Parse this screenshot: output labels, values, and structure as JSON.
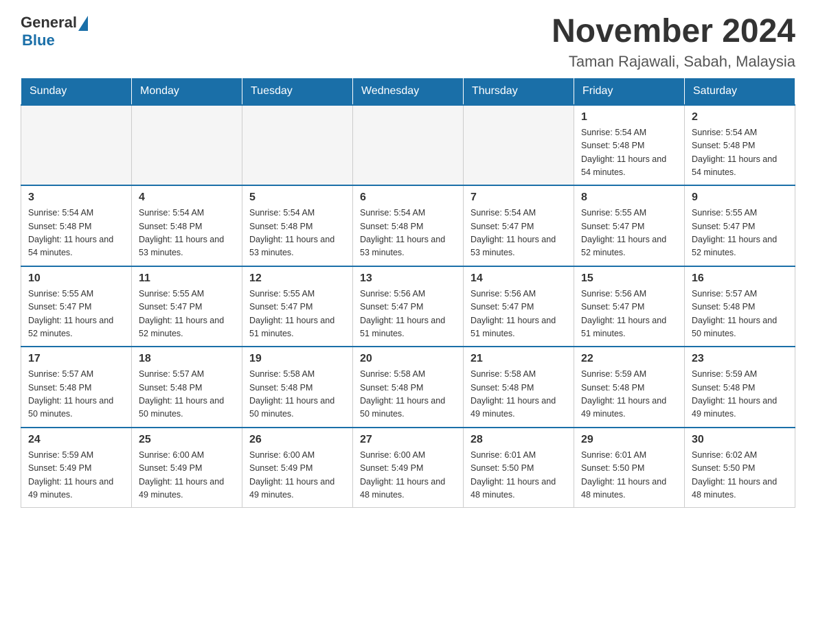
{
  "logo": {
    "general": "General",
    "blue": "Blue"
  },
  "title": "November 2024",
  "subtitle": "Taman Rajawali, Sabah, Malaysia",
  "days_of_week": [
    "Sunday",
    "Monday",
    "Tuesday",
    "Wednesday",
    "Thursday",
    "Friday",
    "Saturday"
  ],
  "weeks": [
    {
      "days": [
        {
          "number": "",
          "empty": true
        },
        {
          "number": "",
          "empty": true
        },
        {
          "number": "",
          "empty": true
        },
        {
          "number": "",
          "empty": true
        },
        {
          "number": "",
          "empty": true
        },
        {
          "number": "1",
          "sunrise": "Sunrise: 5:54 AM",
          "sunset": "Sunset: 5:48 PM",
          "daylight": "Daylight: 11 hours and 54 minutes."
        },
        {
          "number": "2",
          "sunrise": "Sunrise: 5:54 AM",
          "sunset": "Sunset: 5:48 PM",
          "daylight": "Daylight: 11 hours and 54 minutes."
        }
      ]
    },
    {
      "days": [
        {
          "number": "3",
          "sunrise": "Sunrise: 5:54 AM",
          "sunset": "Sunset: 5:48 PM",
          "daylight": "Daylight: 11 hours and 54 minutes."
        },
        {
          "number": "4",
          "sunrise": "Sunrise: 5:54 AM",
          "sunset": "Sunset: 5:48 PM",
          "daylight": "Daylight: 11 hours and 53 minutes."
        },
        {
          "number": "5",
          "sunrise": "Sunrise: 5:54 AM",
          "sunset": "Sunset: 5:48 PM",
          "daylight": "Daylight: 11 hours and 53 minutes."
        },
        {
          "number": "6",
          "sunrise": "Sunrise: 5:54 AM",
          "sunset": "Sunset: 5:48 PM",
          "daylight": "Daylight: 11 hours and 53 minutes."
        },
        {
          "number": "7",
          "sunrise": "Sunrise: 5:54 AM",
          "sunset": "Sunset: 5:47 PM",
          "daylight": "Daylight: 11 hours and 53 minutes."
        },
        {
          "number": "8",
          "sunrise": "Sunrise: 5:55 AM",
          "sunset": "Sunset: 5:47 PM",
          "daylight": "Daylight: 11 hours and 52 minutes."
        },
        {
          "number": "9",
          "sunrise": "Sunrise: 5:55 AM",
          "sunset": "Sunset: 5:47 PM",
          "daylight": "Daylight: 11 hours and 52 minutes."
        }
      ]
    },
    {
      "days": [
        {
          "number": "10",
          "sunrise": "Sunrise: 5:55 AM",
          "sunset": "Sunset: 5:47 PM",
          "daylight": "Daylight: 11 hours and 52 minutes."
        },
        {
          "number": "11",
          "sunrise": "Sunrise: 5:55 AM",
          "sunset": "Sunset: 5:47 PM",
          "daylight": "Daylight: 11 hours and 52 minutes."
        },
        {
          "number": "12",
          "sunrise": "Sunrise: 5:55 AM",
          "sunset": "Sunset: 5:47 PM",
          "daylight": "Daylight: 11 hours and 51 minutes."
        },
        {
          "number": "13",
          "sunrise": "Sunrise: 5:56 AM",
          "sunset": "Sunset: 5:47 PM",
          "daylight": "Daylight: 11 hours and 51 minutes."
        },
        {
          "number": "14",
          "sunrise": "Sunrise: 5:56 AM",
          "sunset": "Sunset: 5:47 PM",
          "daylight": "Daylight: 11 hours and 51 minutes."
        },
        {
          "number": "15",
          "sunrise": "Sunrise: 5:56 AM",
          "sunset": "Sunset: 5:47 PM",
          "daylight": "Daylight: 11 hours and 51 minutes."
        },
        {
          "number": "16",
          "sunrise": "Sunrise: 5:57 AM",
          "sunset": "Sunset: 5:48 PM",
          "daylight": "Daylight: 11 hours and 50 minutes."
        }
      ]
    },
    {
      "days": [
        {
          "number": "17",
          "sunrise": "Sunrise: 5:57 AM",
          "sunset": "Sunset: 5:48 PM",
          "daylight": "Daylight: 11 hours and 50 minutes."
        },
        {
          "number": "18",
          "sunrise": "Sunrise: 5:57 AM",
          "sunset": "Sunset: 5:48 PM",
          "daylight": "Daylight: 11 hours and 50 minutes."
        },
        {
          "number": "19",
          "sunrise": "Sunrise: 5:58 AM",
          "sunset": "Sunset: 5:48 PM",
          "daylight": "Daylight: 11 hours and 50 minutes."
        },
        {
          "number": "20",
          "sunrise": "Sunrise: 5:58 AM",
          "sunset": "Sunset: 5:48 PM",
          "daylight": "Daylight: 11 hours and 50 minutes."
        },
        {
          "number": "21",
          "sunrise": "Sunrise: 5:58 AM",
          "sunset": "Sunset: 5:48 PM",
          "daylight": "Daylight: 11 hours and 49 minutes."
        },
        {
          "number": "22",
          "sunrise": "Sunrise: 5:59 AM",
          "sunset": "Sunset: 5:48 PM",
          "daylight": "Daylight: 11 hours and 49 minutes."
        },
        {
          "number": "23",
          "sunrise": "Sunrise: 5:59 AM",
          "sunset": "Sunset: 5:48 PM",
          "daylight": "Daylight: 11 hours and 49 minutes."
        }
      ]
    },
    {
      "days": [
        {
          "number": "24",
          "sunrise": "Sunrise: 5:59 AM",
          "sunset": "Sunset: 5:49 PM",
          "daylight": "Daylight: 11 hours and 49 minutes."
        },
        {
          "number": "25",
          "sunrise": "Sunrise: 6:00 AM",
          "sunset": "Sunset: 5:49 PM",
          "daylight": "Daylight: 11 hours and 49 minutes."
        },
        {
          "number": "26",
          "sunrise": "Sunrise: 6:00 AM",
          "sunset": "Sunset: 5:49 PM",
          "daylight": "Daylight: 11 hours and 49 minutes."
        },
        {
          "number": "27",
          "sunrise": "Sunrise: 6:00 AM",
          "sunset": "Sunset: 5:49 PM",
          "daylight": "Daylight: 11 hours and 48 minutes."
        },
        {
          "number": "28",
          "sunrise": "Sunrise: 6:01 AM",
          "sunset": "Sunset: 5:50 PM",
          "daylight": "Daylight: 11 hours and 48 minutes."
        },
        {
          "number": "29",
          "sunrise": "Sunrise: 6:01 AM",
          "sunset": "Sunset: 5:50 PM",
          "daylight": "Daylight: 11 hours and 48 minutes."
        },
        {
          "number": "30",
          "sunrise": "Sunrise: 6:02 AM",
          "sunset": "Sunset: 5:50 PM",
          "daylight": "Daylight: 11 hours and 48 minutes."
        }
      ]
    }
  ]
}
